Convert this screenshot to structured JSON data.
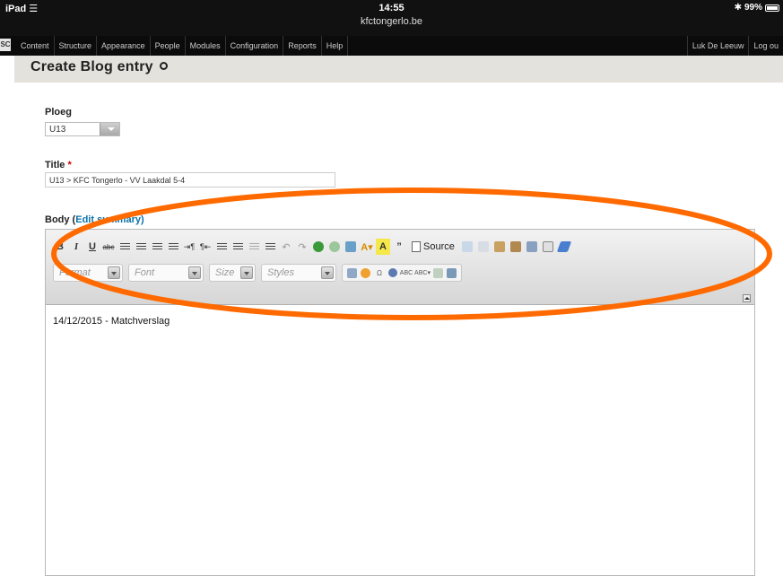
{
  "status_bar": {
    "device": "iPad",
    "time": "14:55",
    "url": "kfctongerlo.be",
    "battery": "99%"
  },
  "admin_bar": {
    "logo": "SC",
    "items": [
      "Content",
      "Structure",
      "Appearance",
      "People",
      "Modules",
      "Configuration",
      "Reports",
      "Help"
    ],
    "user": "Luk De Leeuw",
    "logout": "Log ou"
  },
  "page": {
    "title": "Create Blog entry"
  },
  "form": {
    "ploeg_label": "Ploeg",
    "ploeg_value": "U13",
    "title_label": "Title",
    "title_required": "*",
    "title_value": "U13 > KFC Tongerlo - VV Laakdal 5-4",
    "body_label": "Body (",
    "body_link": "Edit summary",
    "body_close": ")"
  },
  "editor": {
    "source_label": "Source",
    "format_placeholder": "Format",
    "font_placeholder": "Font",
    "size_placeholder": "Size",
    "styles_placeholder": "Styles",
    "content": "14/12/2015 - Matchverslag"
  },
  "annotation": {
    "color": "#ff6a00"
  }
}
